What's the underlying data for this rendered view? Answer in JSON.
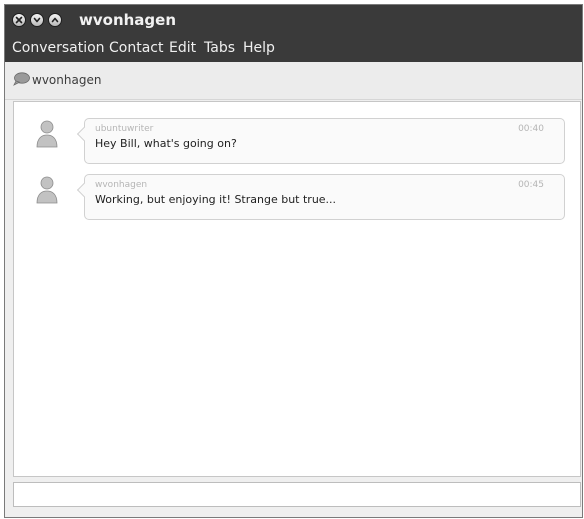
{
  "window": {
    "title": "wvonhagen",
    "title_icons": [
      "close-icon",
      "minimize-icon",
      "maximize-icon"
    ]
  },
  "menu": {
    "items": [
      "Conversation",
      "Contact",
      "Edit",
      "Tabs",
      "Help"
    ]
  },
  "tab": {
    "label": "wvonhagen",
    "icon": "chat-bubble-icon"
  },
  "messages": [
    {
      "sender": "ubuntuwriter",
      "time": "00:40",
      "text": "Hey Bill, what's going on?"
    },
    {
      "sender": "wvonhagen",
      "time": "00:45",
      "text": "Working, but enjoying it! Strange but true..."
    }
  ],
  "input": {
    "value": ""
  },
  "colors": {
    "titlebar": "#3a3a3a",
    "window_bg": "#efefef",
    "bubble_bg": "#fafafa",
    "bubble_border": "#d1d1d1"
  }
}
